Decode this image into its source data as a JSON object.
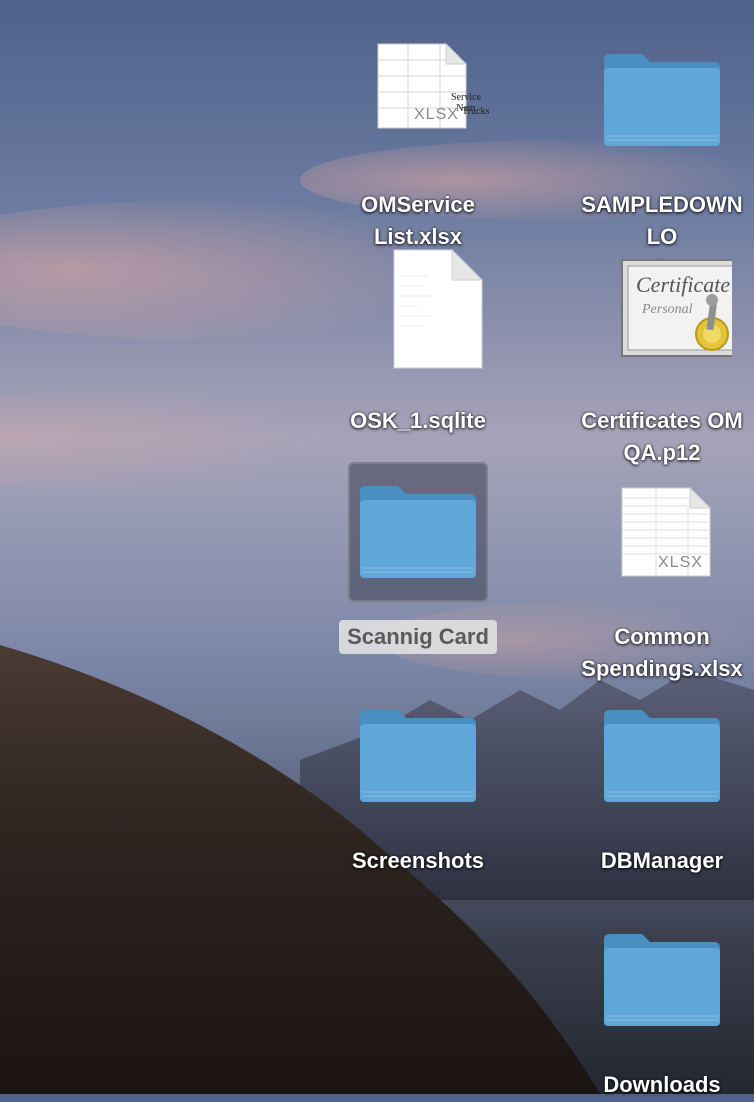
{
  "desktop": {
    "icons": [
      {
        "label": "OMService\nList.xlsx",
        "kind": "spreadsheet",
        "badge": "XLSX",
        "preview": [
          "Service Nam",
          "Trucks"
        ]
      },
      {
        "label": "SAMPLEDOWNLO\nD",
        "kind": "folder"
      },
      {
        "label": "OSK_1.sqlite",
        "kind": "document"
      },
      {
        "label": "Certificates OM\nQA.p12",
        "kind": "certificate",
        "preview": [
          "Certificate",
          "Personal"
        ]
      },
      {
        "label": "Scannig Card",
        "kind": "folder",
        "selected": true
      },
      {
        "label": "Common\nSpendings.xlsx",
        "kind": "spreadsheet",
        "badge": "XLSX"
      },
      {
        "label": "Screenshots",
        "kind": "folder"
      },
      {
        "label": "DBManager",
        "kind": "folder"
      },
      {
        "label": "Downloads",
        "kind": "folder"
      }
    ]
  },
  "colors": {
    "folder": "#5fa7d8",
    "folder_tab": "#4a8fc2",
    "selection": "#e1e1e1"
  }
}
